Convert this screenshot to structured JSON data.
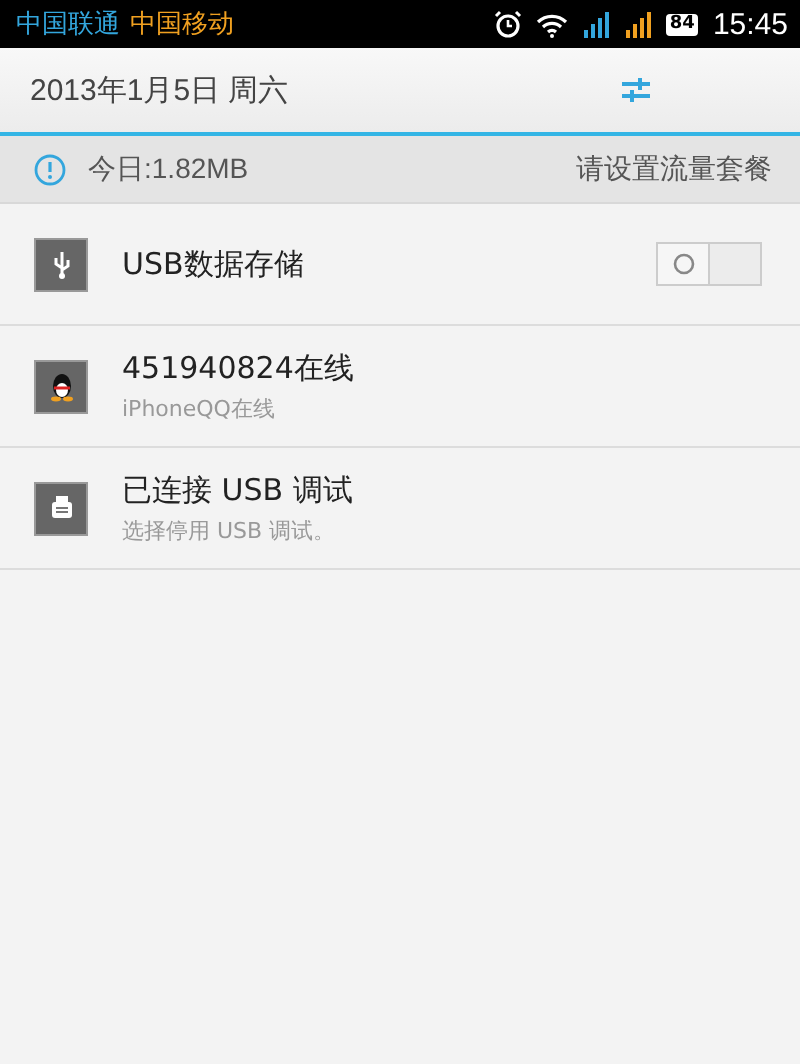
{
  "status_bar": {
    "carriers": [
      {
        "name": "中国联通",
        "color": "#33a6dd"
      },
      {
        "name": "中国移动",
        "color": "#f0a020"
      }
    ],
    "battery": "84",
    "time": "15:45"
  },
  "header": {
    "date": "2013年1月5日 周六"
  },
  "data_usage": {
    "today": "今日:1.82MB",
    "action": "请设置流量套餐"
  },
  "notifications": [
    {
      "kind": "toggle",
      "title": "USB数据存储",
      "on": false
    },
    {
      "kind": "text",
      "title": "451940824在线",
      "subtitle": "iPhoneQQ在线"
    },
    {
      "kind": "text",
      "title": "已连接 USB 调试",
      "subtitle": "选择停用 USB 调试。"
    }
  ]
}
